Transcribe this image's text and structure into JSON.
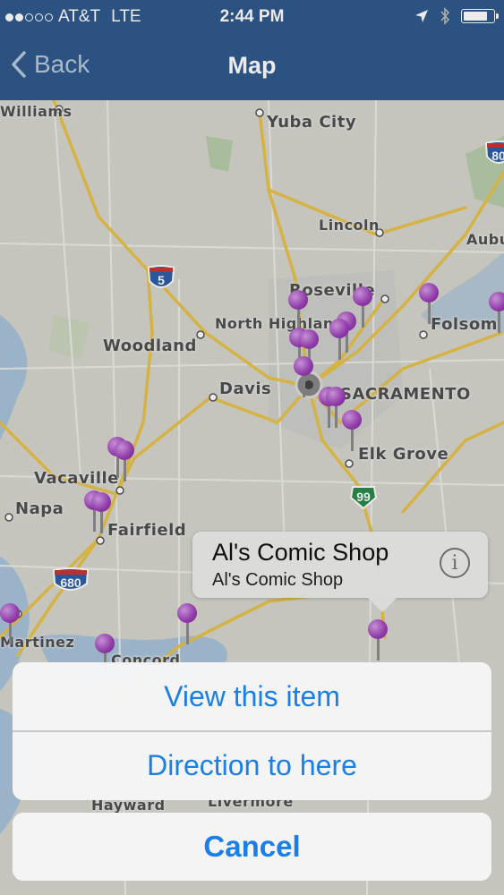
{
  "status_bar": {
    "carrier": "AT&T",
    "network": "LTE",
    "time": "2:44 PM"
  },
  "nav": {
    "back_label": "Back",
    "title": "Map"
  },
  "map": {
    "cities": {
      "williams": "Williams",
      "yuba_city": "Yuba City",
      "lincoln": "Lincoln",
      "auburn": "Aubu",
      "roseville": "Roseville",
      "north_highlands": "North Highlands",
      "woodland": "Woodland",
      "folsom": "Folsom",
      "davis": "Davis",
      "sacramento": "SACRAMENTO",
      "elk_grove": "Elk Grove",
      "vacaville": "Vacaville",
      "napa": "Napa",
      "fairfield": "Fairfield",
      "martinez": "Martinez",
      "concord": "Concord",
      "hayward": "Hayward",
      "livermore": "Livermore"
    },
    "shields": {
      "i5": "5",
      "i80": "80",
      "i680": "680",
      "sr99": "99"
    },
    "colors": {
      "pin": "#9b3fb7",
      "road": "#e8c24a",
      "water": "#a9c3d9"
    }
  },
  "callout": {
    "title": "Al's Comic Shop",
    "subtitle": "Al's Comic Shop",
    "info_icon": "i"
  },
  "action_sheet": {
    "view_item": "View this item",
    "directions": "Direction to here",
    "cancel": "Cancel"
  }
}
